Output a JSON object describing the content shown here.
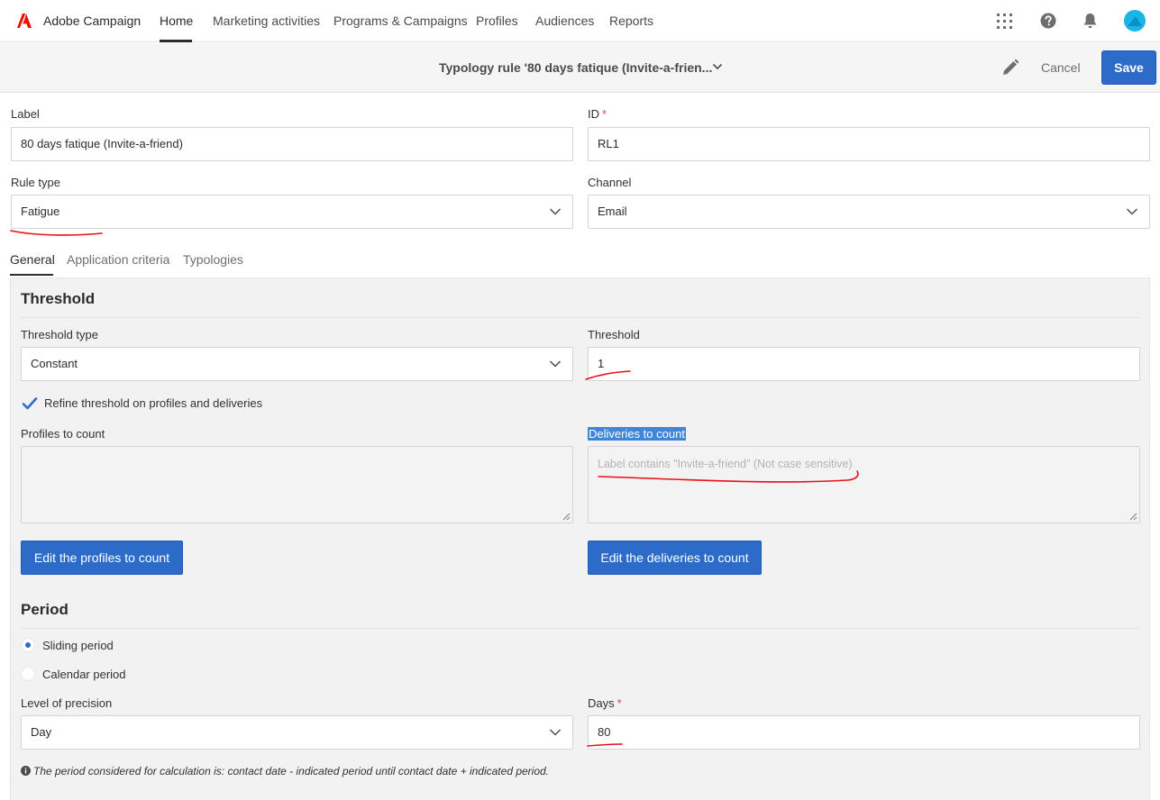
{
  "app": {
    "name": "Adobe Campaign"
  },
  "nav": {
    "items": [
      "Home",
      "Marketing activities",
      "Programs & Campaigns",
      "Profiles",
      "Audiences",
      "Reports"
    ]
  },
  "header": {
    "title": "Typology rule '80 days fatique (Invite-a-frien...",
    "cancel_label": "Cancel",
    "save_label": "Save"
  },
  "form": {
    "label_label": "Label",
    "label_value": "80 days fatique (Invite-a-friend)",
    "id_label": "ID",
    "id_required": "*",
    "id_value": "RL1",
    "rule_type_label": "Rule type",
    "rule_type_value": "Fatigue",
    "channel_label": "Channel",
    "channel_value": "Email"
  },
  "tabs": [
    "General",
    "Application criteria",
    "Typologies"
  ],
  "threshold": {
    "title": "Threshold",
    "type_label": "Threshold type",
    "type_value": "Constant",
    "threshold_label": "Threshold",
    "threshold_value": "1",
    "refine_label": "Refine threshold on profiles and deliveries",
    "profiles_label": "Profiles to count",
    "deliveries_label": "Deliveries to count",
    "deliveries_value": "Label contains \"Invite-a-friend\" (Not case sensitive)",
    "edit_profiles_btn": "Edit the profiles to count",
    "edit_deliveries_btn": "Edit the deliveries to count"
  },
  "period": {
    "title": "Period",
    "sliding_label": "Sliding period",
    "calendar_label": "Calendar period",
    "precision_label": "Level of precision",
    "precision_value": "Day",
    "days_label": "Days",
    "days_required": "*",
    "days_value": "80",
    "note": "The period considered for calculation is: contact date - indicated period until contact date + indicated period."
  },
  "colors": {
    "accent": "#2d6bc9",
    "annotation": "#e8101a",
    "brand": "#eb1000"
  }
}
